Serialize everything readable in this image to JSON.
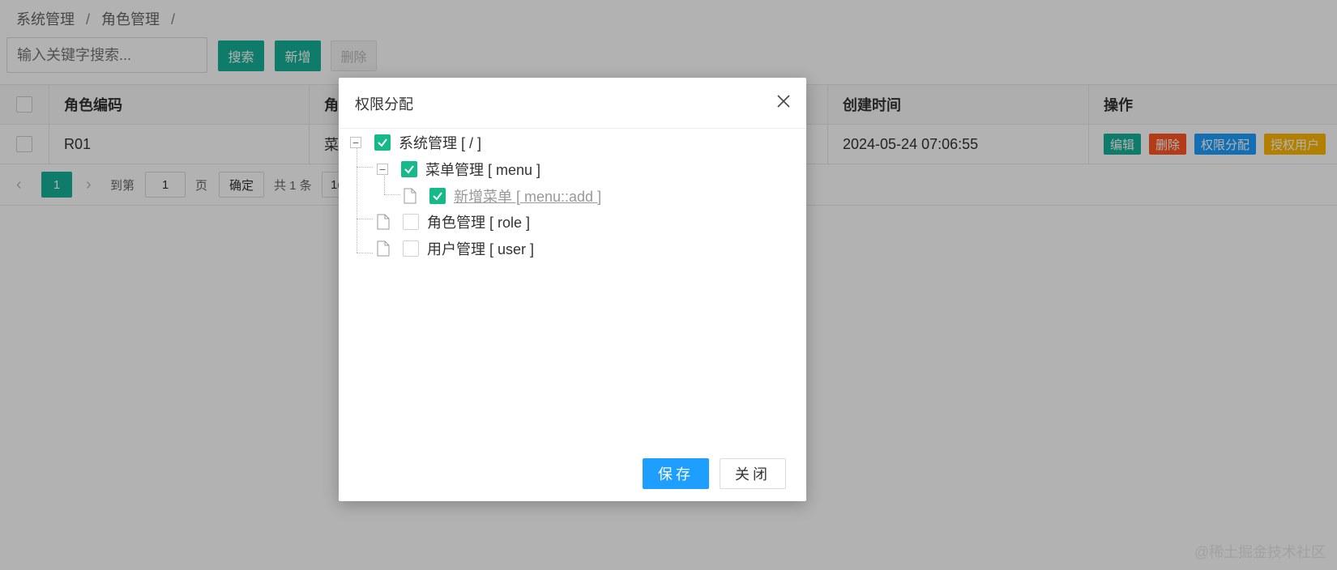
{
  "breadcrumb": {
    "items": [
      "系统管理",
      "角色管理"
    ],
    "separator": "/"
  },
  "toolbar": {
    "search_placeholder": "输入关键字搜索...",
    "search_label": "搜索",
    "add_label": "新增",
    "delete_label": "删除"
  },
  "table": {
    "headers": [
      "角色编码",
      "角",
      "创建时间",
      "操作"
    ],
    "rows": [
      {
        "code": "R01",
        "name": "菜",
        "created": "2024-05-24 07:06:55"
      }
    ],
    "actions": {
      "edit": "编辑",
      "delete": "删除",
      "perm": "权限分配",
      "auth": "授权用户"
    }
  },
  "pagination": {
    "prev": "‹",
    "current": "1",
    "next": "›",
    "goto_label": "到第",
    "goto_value": "1",
    "page_label": "页",
    "confirm": "确定",
    "total": "共 1 条",
    "size": "1("
  },
  "modal": {
    "title": "权限分配",
    "tree": [
      {
        "label": "系统管理 [ / ]",
        "checked": true
      },
      {
        "label": "菜单管理 [ menu ]",
        "checked": true
      },
      {
        "label": "新增菜单 [ menu::add ]",
        "checked": true
      },
      {
        "label": "角色管理 [ role ]",
        "checked": false
      },
      {
        "label": "用户管理 [ user ]",
        "checked": false
      }
    ],
    "save_label": "保存",
    "close_label": "关闭"
  },
  "watermark": "@稀土掘金技术社区",
  "colors": {
    "teal": "#16b198",
    "check_green": "#16b98a",
    "blue": "#1e9fff",
    "red": "#ff5722",
    "orange": "#ffb800"
  }
}
